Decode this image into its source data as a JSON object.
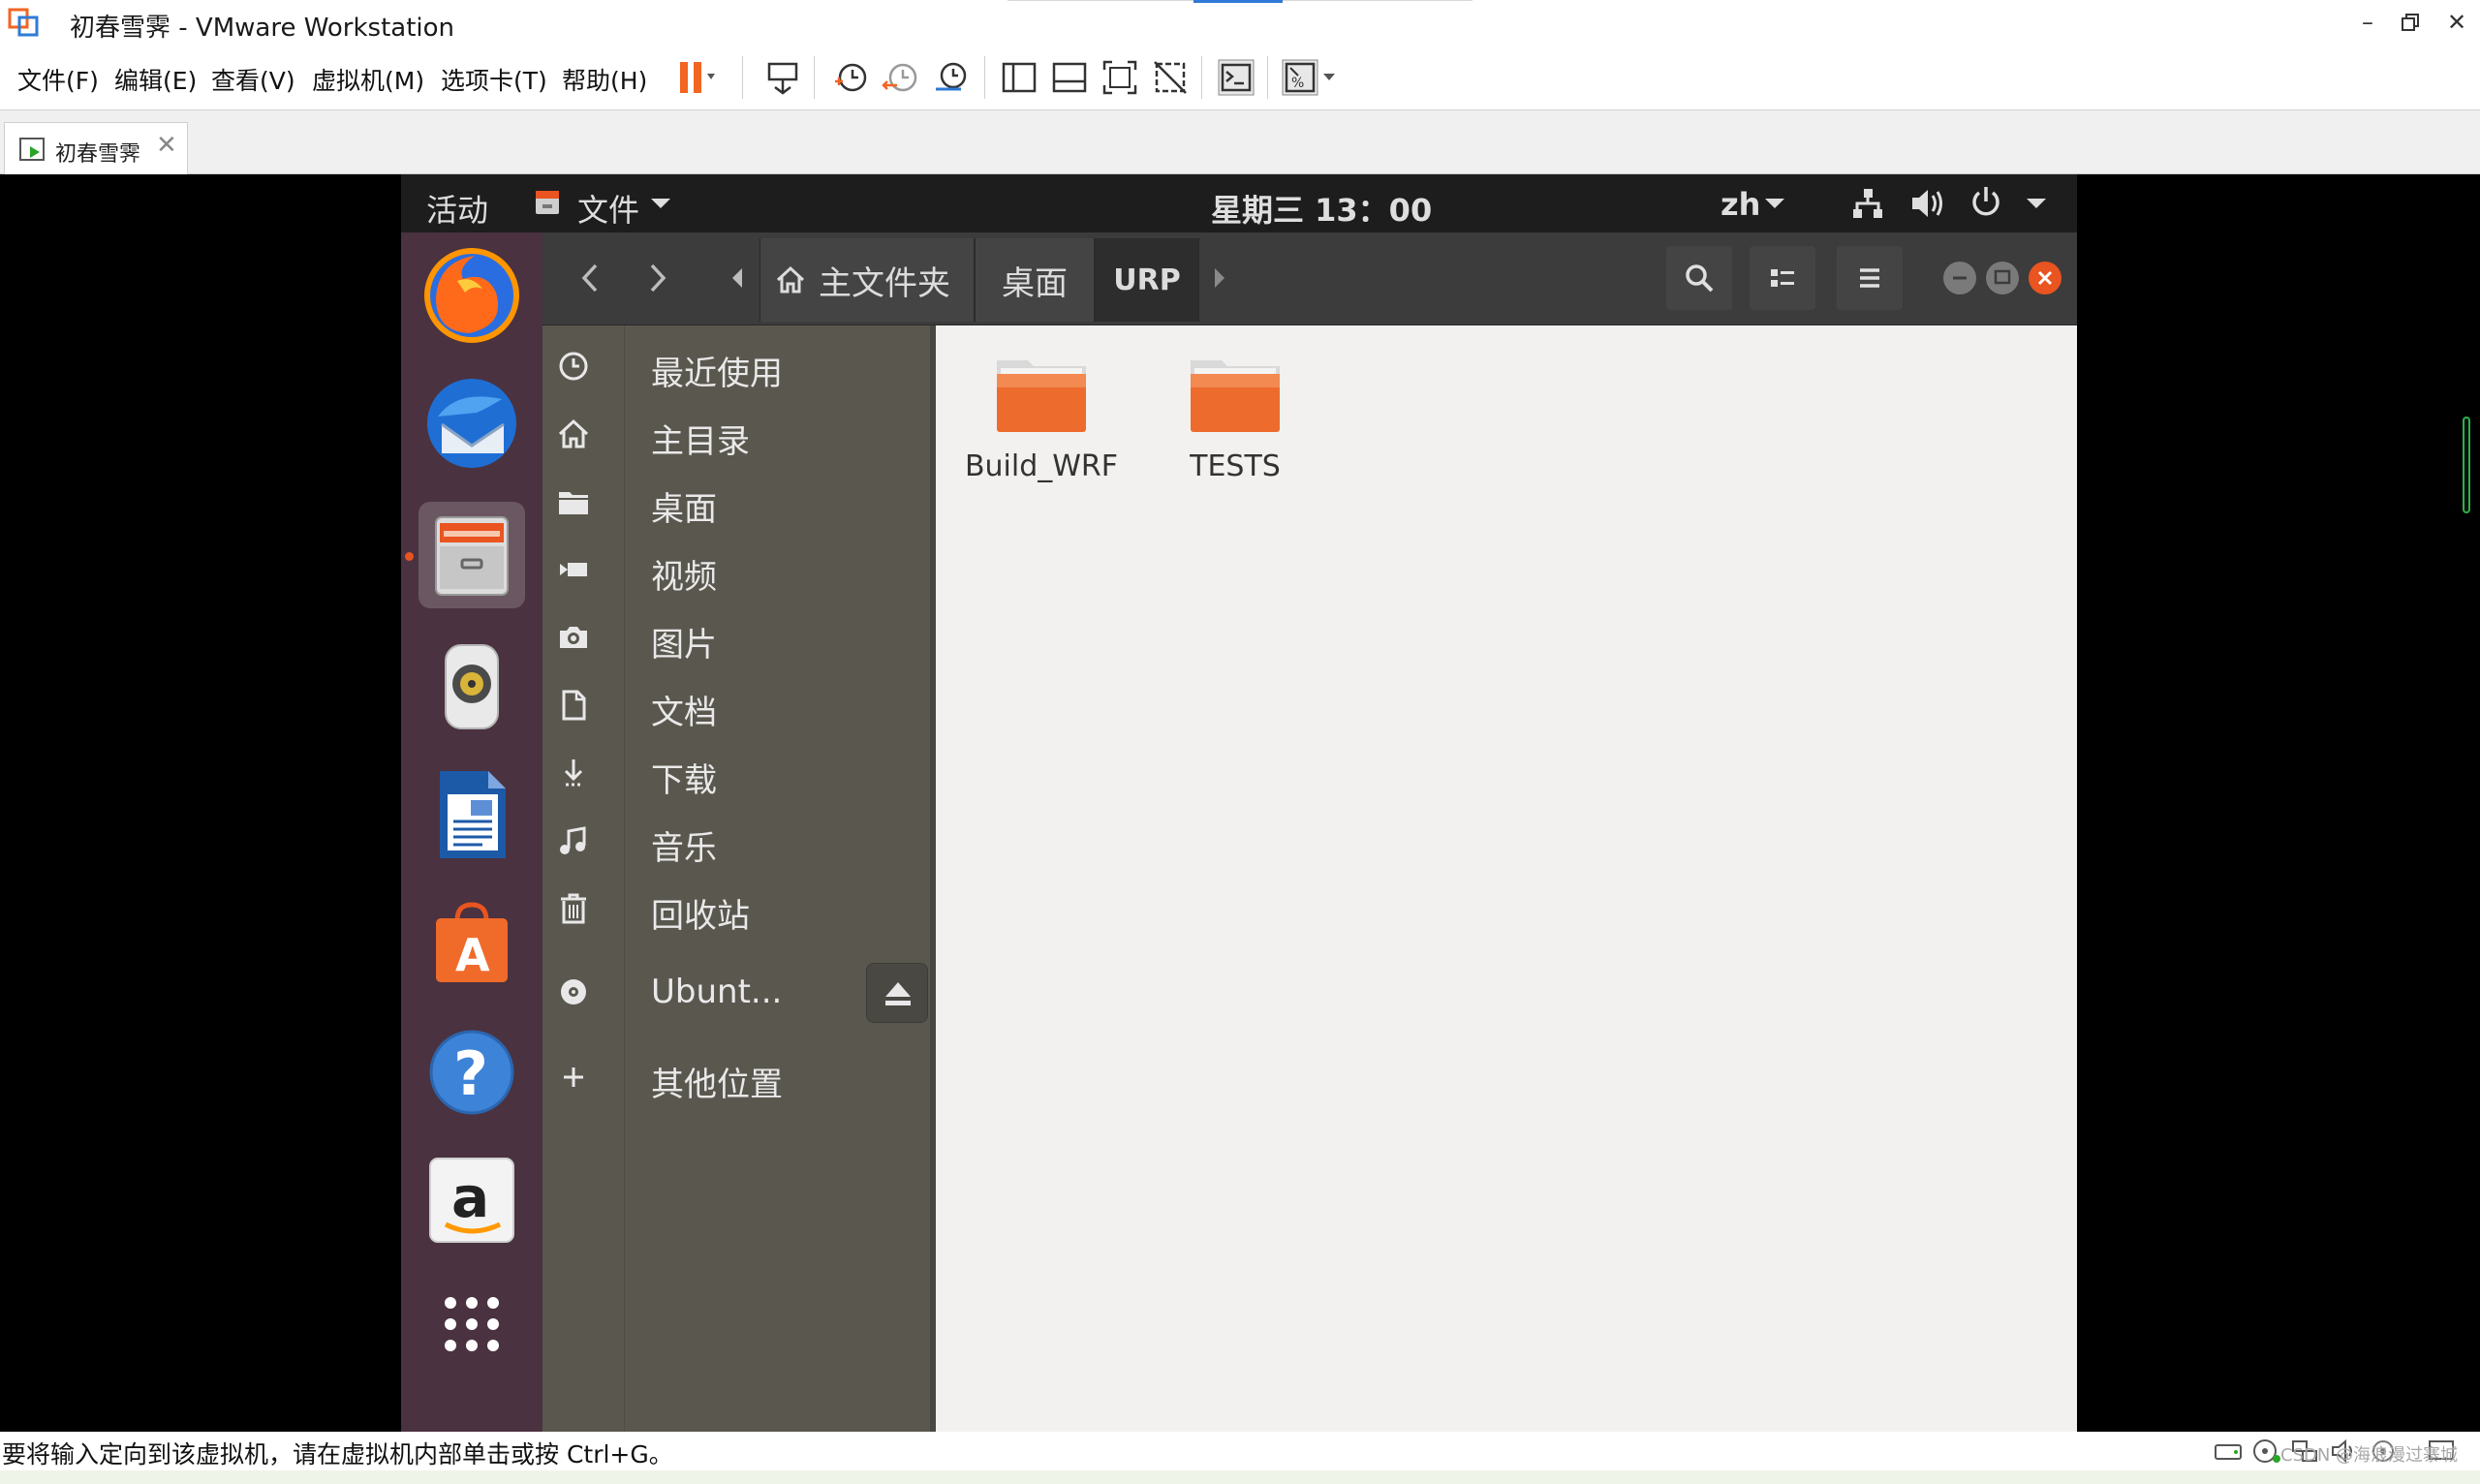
{
  "window": {
    "title": "初春雪霁 - VMware Workstation"
  },
  "menubar": {
    "items": [
      "文件(F)",
      "编辑(E)",
      "查看(V)",
      "虚拟机(M)",
      "选项卡(T)",
      "帮助(H)"
    ]
  },
  "tab": {
    "label": "初春雪霁"
  },
  "guest_topbar": {
    "activities": "活动",
    "app_menu": "文件",
    "clock": "星期三 13：00",
    "input_method": "zh"
  },
  "dock": {
    "apps": [
      "firefox-icon",
      "thunderbird-icon",
      "files-icon",
      "rhythmbox-icon",
      "libreoffice-writer-icon",
      "ubuntu-software-icon",
      "help-icon",
      "amazon-icon",
      "show-apps-icon"
    ]
  },
  "nautilus": {
    "breadcrumbs": [
      "主文件夹",
      "桌面",
      "URP"
    ],
    "sidebar": [
      {
        "label": "最近使用",
        "icon": "clock-icon"
      },
      {
        "label": "主目录",
        "icon": "home-icon"
      },
      {
        "label": "桌面",
        "icon": "folder-icon"
      },
      {
        "label": "视频",
        "icon": "video-icon"
      },
      {
        "label": "图片",
        "icon": "camera-icon"
      },
      {
        "label": "文档",
        "icon": "document-icon"
      },
      {
        "label": "下载",
        "icon": "download-icon"
      },
      {
        "label": "音乐",
        "icon": "music-icon"
      },
      {
        "label": "回收站",
        "icon": "trash-icon"
      },
      {
        "label": "Ubunt...",
        "icon": "disc-icon"
      },
      {
        "label": "其他位置",
        "icon": "plus-icon"
      }
    ],
    "files": [
      {
        "name": "Build_WRF"
      },
      {
        "name": "TESTS"
      }
    ]
  },
  "statusbar": {
    "text": "要将输入定向到该虚拟机，请在虚拟机内部单击或按 Ctrl+G。",
    "watermark": "CSDN @海浪漫过寨城"
  },
  "colors": {
    "ubuntu_orange": "#e95420",
    "dock_bg": "#4a3240",
    "pause_orange": "#f26522"
  }
}
